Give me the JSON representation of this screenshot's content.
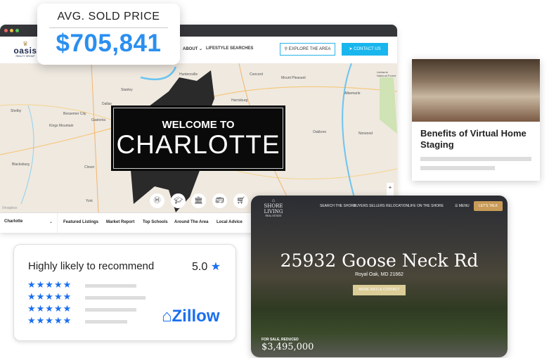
{
  "colors": {
    "accent_blue": "#2a8ff0",
    "cyan": "#19b6ee",
    "gold": "#c99b58",
    "zillow_blue": "#1a6ff0"
  },
  "oasis_site": {
    "logo": {
      "name": "oasis",
      "sub": "REALTY GROUP"
    },
    "nav": [
      "ABOUT ⌄",
      "LIFESTYLE SEARCHES"
    ],
    "explore_label": "EXPLORE THE AREA",
    "contact_label": "CONTACT US",
    "map": {
      "towns": [
        "Huntersville",
        "Concord",
        "Mount Pleasant",
        "Stanley",
        "Harrisburg",
        "Albemarle",
        "Dallas",
        "Shelby",
        "Bessemer City",
        "Gastonia",
        "Kings Mountain",
        "Oakboro",
        "Norwood",
        "Blacksburg",
        "Clover",
        "York",
        "Uwharrie National Forest"
      ],
      "attribution": "©mapbox",
      "zoom_in": "+",
      "zoom_out": "−"
    },
    "welcome": {
      "line1": "WELCOME TO",
      "line2": "CHARLOTTE"
    },
    "map_icons": [
      "hospital-icon",
      "graduation-cap-icon",
      "government-building-icon",
      "bus-icon",
      "shopping-cart-icon"
    ],
    "city_select": "Charlotte",
    "tabs": [
      "Featured Listings",
      "Market Report",
      "Top Schools",
      "Around The Area",
      "Local Advice"
    ]
  },
  "avg_price": {
    "label": "AVG. SOLD PRICE",
    "value": "$705,841"
  },
  "blog": {
    "title": "Benefits of Virtual Home Staging"
  },
  "shore": {
    "logo": "SHORE LIVING",
    "logo_sub": "REAL ESTATE",
    "nav": [
      "SEARCH THE SHORE",
      "BUYERS",
      "SELLERS",
      "RELOCATION",
      "LIFE ON THE SHORE"
    ],
    "menu": "MENU",
    "cta": "LET'S TALK",
    "address": "25932 Goose Neck Rd",
    "city": "Royal Oak, MD 21662",
    "more": "MORE INFO & CONTACT",
    "status": "FOR SALE, REDUCED",
    "price": "$3,495,000"
  },
  "zillow": {
    "heading": "Highly likely to recommend",
    "rating": "5.0",
    "rating_stars": 5,
    "logo": "Zillow"
  }
}
